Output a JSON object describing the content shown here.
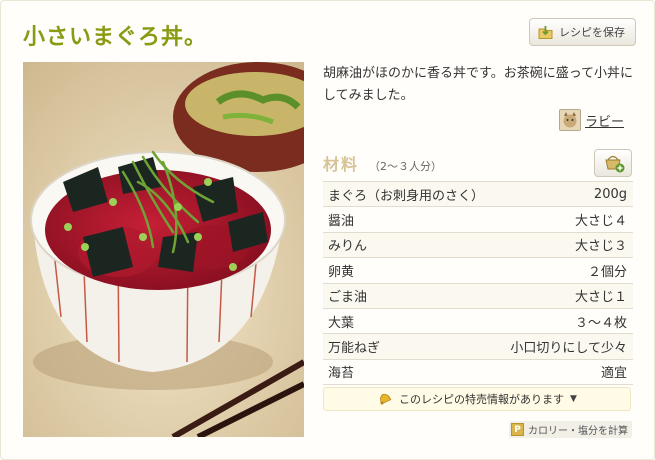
{
  "recipe": {
    "title": "小さいまぐろ丼。",
    "save_label": "レシピを保存",
    "description": "胡麻油がほのかに香る丼です。お茶碗に盛って小丼にしてみました。",
    "author": "ラビー"
  },
  "ingredients": {
    "heading": "材料",
    "servings": "（2〜３人分）",
    "items": [
      {
        "name": "まぐろ（お刺身用のさく）",
        "qty": "200g"
      },
      {
        "name": "醤油",
        "qty": "大さじ４"
      },
      {
        "name": "みりん",
        "qty": "大さじ３"
      },
      {
        "name": "卵黄",
        "qty": "２個分"
      },
      {
        "name": "ごま油",
        "qty": "大さじ１"
      },
      {
        "name": "大葉",
        "qty": "３〜４枚"
      },
      {
        "name": "万能ねぎ",
        "qty": "小口切りにして少々"
      },
      {
        "name": "海苔",
        "qty": "適宜"
      }
    ]
  },
  "promo": {
    "text": "このレシピの特売情報があります",
    "icon": "bell-icon",
    "arrow": "▼"
  },
  "calorie": {
    "badge": "P",
    "label": "カロリー・塩分を計算"
  },
  "colors": {
    "title": "#8a9a13",
    "heading": "#d6c497",
    "tuna": "#a3122a"
  }
}
